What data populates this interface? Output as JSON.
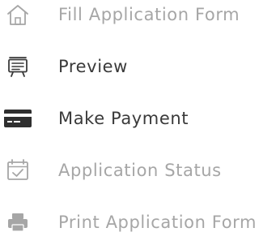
{
  "menu": {
    "items": [
      {
        "label": "Fill Application Form",
        "icon": "home-icon",
        "state": "disabled"
      },
      {
        "label": "Preview",
        "icon": "preview-board-icon",
        "state": "enabled"
      },
      {
        "label": "Make Payment",
        "icon": "credit-card-icon",
        "state": "enabled"
      },
      {
        "label": "Application Status",
        "icon": "calendar-check-icon",
        "state": "disabled"
      },
      {
        "label": "Print Application Form",
        "icon": "printer-icon",
        "state": "disabled"
      }
    ]
  },
  "colors": {
    "disabled": "#a6a6a6",
    "enabled": "#3a3a3a",
    "card": "#2f2f2f"
  }
}
